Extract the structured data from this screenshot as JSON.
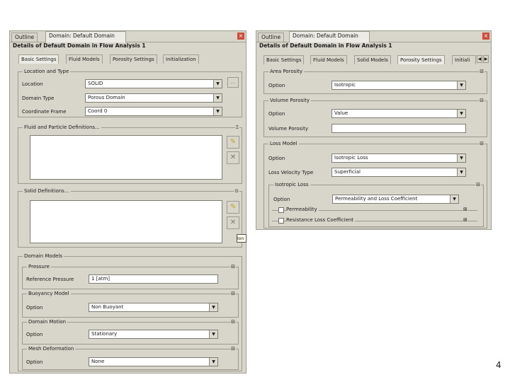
{
  "left": {
    "tabs": {
      "outline": "Outline",
      "domain": "Domain: Default Domain"
    },
    "close_glyph": "×",
    "title": "Details of Default Domain in Flow Analysis 1",
    "subtabs": {
      "basic": "Basic Settings",
      "fluid": "Fluid Models",
      "porosity": "Porosity Settings",
      "init": "Initialization"
    },
    "location_type": {
      "label": "Location and Type",
      "location_label": "Location",
      "location_value": "SOLID",
      "browse": "...",
      "domain_type_label": "Domain Type",
      "domain_type_value": "Porous Domain",
      "coord_label": "Coordinate Frame",
      "coord_value": "Coord 0"
    },
    "fluid_defs": {
      "label": "Fluid and Particle Definitions...",
      "toggle": "Ξ"
    },
    "solid_defs": {
      "label": "Solid Definitions...",
      "toggle": "⊙",
      "tooltip": "Ion"
    },
    "domain_models": {
      "label": "Domain Models",
      "pressure": {
        "label": "Pressure",
        "ref_label": "Reference Pressure",
        "ref_value": "1 [atm]"
      },
      "buoyancy": {
        "label": "Buoyancy Model",
        "option_label": "Option",
        "option_value": "Non Buoyant"
      },
      "motion": {
        "label": "Domain Motion",
        "option_label": "Option",
        "option_value": "Stationary"
      },
      "mesh": {
        "label": "Mesh Deformation",
        "option_label": "Option",
        "option_value": "None"
      }
    },
    "collapse": "⊟"
  },
  "right": {
    "tabs": {
      "outline": "Outline",
      "domain": "Domain: Default Domain"
    },
    "close_glyph": "×",
    "title": "Details of Default Domain in Flow Analysis 1",
    "subtabs": {
      "basic": "Basic Settings",
      "fluid": "Fluid Models",
      "solid": "Solid Models",
      "porosity": "Porosity Settings",
      "init": "Initiali"
    },
    "area": {
      "label": "Area Porosity",
      "option_label": "Option",
      "option_value": "Isotropic"
    },
    "volume": {
      "label": "Volume Porosity",
      "option_label": "Option",
      "option_value": "Value",
      "vp_label": "Volume Porosity",
      "vp_value": ""
    },
    "loss": {
      "label": "Loss Model",
      "option_label": "Option",
      "option_value": "Isotropic Loss",
      "lvt_label": "Loss Velocity Type",
      "lvt_value": "Superficial",
      "iso": {
        "label": "Isotropic Loss",
        "option_label": "Option",
        "option_value": "Permeability and Loss Coefficient"
      },
      "permeability": "Permeability",
      "resistance": "Resistance Loss Coefficient"
    },
    "collapse": "⊟",
    "expand": "⊞"
  },
  "page_number": "4"
}
